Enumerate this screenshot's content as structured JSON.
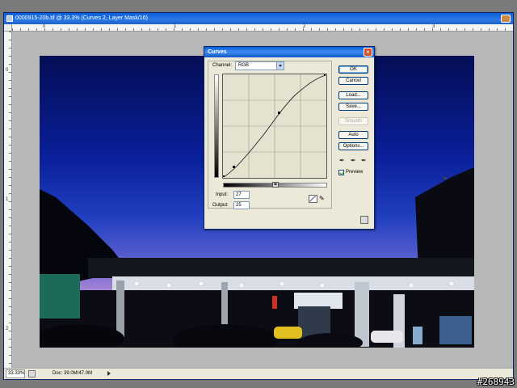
{
  "document": {
    "title": "0000915-20b.tif @ 33.3% (Curves 2, Layer Mask/16)",
    "ruler_top_numbers": [
      "0",
      "1",
      "2",
      "3",
      "4"
    ],
    "ruler_left_numbers": [
      "0",
      "1",
      "2"
    ],
    "status": {
      "zoom": "33.33%",
      "doc_size": "Doc: 39.0M/47.0M"
    }
  },
  "curves_dialog": {
    "title": "Curves",
    "channel_label": "Channel:",
    "channel_value": "RGB",
    "buttons": {
      "ok": "OK",
      "cancel": "Cancel",
      "load": "Load...",
      "save": "Save...",
      "smooth": "Smooth",
      "auto": "Auto",
      "options": "Options..."
    },
    "preview_label": "Preview",
    "preview_checked": true,
    "input_label": "Input:",
    "input_value": "27",
    "output_label": "Output:",
    "output_value": "25"
  },
  "watermark": "#268943"
}
